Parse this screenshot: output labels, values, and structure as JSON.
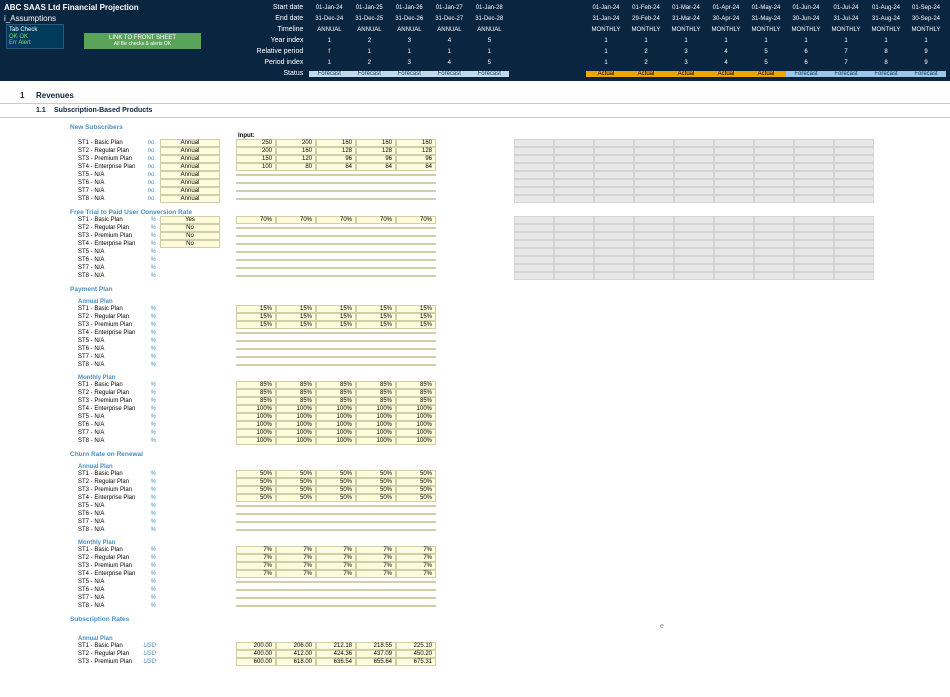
{
  "header": {
    "title": "ABC SAAS Ltd Financial Projection",
    "subtitle": "i_Assumptions",
    "labels": [
      "Start date",
      "End date",
      "Timeline",
      "Year index",
      "Relative period",
      "Period index",
      "Status"
    ],
    "years": [
      "01-Jan-24",
      "01-Jan-25",
      "01-Jan-26",
      "01-Jan-27",
      "01-Jan-28"
    ],
    "years_end": [
      "31-Dec-24",
      "31-Dec-25",
      "31-Dec-26",
      "31-Dec-27",
      "31-Dec-28"
    ],
    "years_timeline": [
      "ANNUAL",
      "ANNUAL",
      "ANNUAL",
      "ANNUAL",
      "ANNUAL"
    ],
    "years_index": [
      "1",
      "2",
      "3",
      "4",
      "5"
    ],
    "years_rel": [
      "f",
      "1",
      "1",
      "1",
      "1"
    ],
    "years_pidx": [
      "1",
      "2",
      "3",
      "4",
      "5"
    ],
    "months": [
      "01-Jan-24",
      "01-Feb-24",
      "01-Mar-24",
      "01-Apr-24",
      "01-May-24",
      "01-Jun-24",
      "01-Jul-24",
      "01-Aug-24",
      "01-Sep-24"
    ],
    "months_end": [
      "31-Jan-24",
      "29-Feb-24",
      "31-Mar-24",
      "30-Apr-24",
      "31-May-24",
      "30-Jun-24",
      "31-Jul-24",
      "31-Aug-24",
      "30-Sep-24"
    ],
    "months_timeline": [
      "MONTHLY",
      "MONTHLY",
      "MONTHLY",
      "MONTHLY",
      "MONTHLY",
      "MONTHLY",
      "MONTHLY",
      "MONTHLY",
      "MONTHLY"
    ],
    "months_yidx": [
      "1",
      "1",
      "1",
      "1",
      "1",
      "1",
      "1",
      "1",
      "1"
    ],
    "months_rel": [
      "1",
      "2",
      "3",
      "4",
      "5",
      "6",
      "7",
      "8",
      "9"
    ],
    "months_pidx": [
      "1",
      "2",
      "3",
      "4",
      "5",
      "6",
      "7",
      "8",
      "9"
    ],
    "status_years": [
      "Forecast",
      "Forecast",
      "Forecast",
      "Forecast",
      "Forecast"
    ],
    "status_months": [
      "Actual",
      "Actual",
      "Actual",
      "Actual",
      "Actual",
      "Forecast",
      "Forecast",
      "Forecast",
      "Forecast"
    ]
  },
  "tabcheck": {
    "title": "Tab Check",
    "ok": "OK  OK",
    "err": "Err",
    "alert": "Alert"
  },
  "linksheet": {
    "main": "LINK TO FRONT SHEET",
    "sub": "All file checks & alerts OK"
  },
  "section": {
    "num": "1",
    "title": "Revenues"
  },
  "subsection": {
    "num": "1.1",
    "title": "Subscription-Based Products"
  },
  "plans": [
    "ST1 - Basic Plan",
    "ST2 - Regular Plan",
    "ST3 - Premium Plan",
    "ST4 - Enterprise Plan",
    "ST5 - N/A",
    "ST6 - N/A",
    "ST7 - N/A",
    "ST8 - N/A"
  ],
  "blocks": {
    "newsubs": {
      "title": "New Subscribers",
      "input_label": "Input:",
      "unit": "no.",
      "freq": [
        "Annual",
        "Annual",
        "Annual",
        "Annual",
        "Annual",
        "Annual",
        "Annual",
        "Annual"
      ],
      "data": [
        [
          "250",
          "200",
          "160",
          "160",
          "160"
        ],
        [
          "200",
          "160",
          "128",
          "128",
          "128"
        ],
        [
          "150",
          "120",
          "96",
          "96",
          "96"
        ],
        [
          "100",
          "80",
          "64",
          "64",
          "64"
        ],
        [
          "",
          "",
          "",
          "",
          ""
        ],
        [
          "",
          "",
          "",
          "",
          ""
        ],
        [
          "",
          "",
          "",
          "",
          ""
        ],
        [
          "",
          "",
          "",
          "",
          ""
        ]
      ]
    },
    "freetrial": {
      "title": "Free Trial to Paid User Conversion Rate",
      "unit": "%",
      "freq": [
        "Yes",
        "No",
        "No",
        "No",
        "",
        "",
        "",
        ""
      ],
      "data": [
        [
          "70%",
          "70%",
          "70%",
          "70%",
          "70%"
        ],
        [
          "",
          "",
          "",
          "",
          ""
        ],
        [
          "",
          "",
          "",
          "",
          ""
        ],
        [
          "",
          "",
          "",
          "",
          ""
        ],
        [
          "",
          "",
          "",
          "",
          ""
        ],
        [
          "",
          "",
          "",
          "",
          ""
        ],
        [
          "",
          "",
          "",
          "",
          ""
        ],
        [
          "",
          "",
          "",
          "",
          ""
        ]
      ],
      "grey": true
    },
    "payment": {
      "title": "Payment Plan"
    },
    "annualplan": {
      "subtitle": "Annual Plan",
      "unit": "%",
      "data": [
        [
          "15%",
          "15%",
          "15%",
          "15%",
          "15%"
        ],
        [
          "15%",
          "15%",
          "15%",
          "15%",
          "15%"
        ],
        [
          "15%",
          "15%",
          "15%",
          "15%",
          "15%"
        ],
        [
          "",
          "",
          "",
          "",
          ""
        ],
        [
          "",
          "",
          "",
          "",
          ""
        ],
        [
          "",
          "",
          "",
          "",
          ""
        ],
        [
          "",
          "",
          "",
          "",
          ""
        ],
        [
          "",
          "",
          "",
          "",
          ""
        ]
      ]
    },
    "monthlyplan": {
      "subtitle": "Monthly Plan",
      "unit": "%",
      "data": [
        [
          "85%",
          "85%",
          "85%",
          "85%",
          "85%"
        ],
        [
          "85%",
          "85%",
          "85%",
          "85%",
          "85%"
        ],
        [
          "85%",
          "85%",
          "85%",
          "85%",
          "85%"
        ],
        [
          "100%",
          "100%",
          "100%",
          "100%",
          "100%"
        ],
        [
          "100%",
          "100%",
          "100%",
          "100%",
          "100%"
        ],
        [
          "100%",
          "100%",
          "100%",
          "100%",
          "100%"
        ],
        [
          "100%",
          "100%",
          "100%",
          "100%",
          "100%"
        ],
        [
          "100%",
          "100%",
          "100%",
          "100%",
          "100%"
        ]
      ]
    },
    "churn": {
      "title": "Churn Rate on Renewal"
    },
    "churn_annual": {
      "subtitle": "Annual Plan",
      "unit": "%",
      "data": [
        [
          "50%",
          "50%",
          "50%",
          "50%",
          "50%"
        ],
        [
          "50%",
          "50%",
          "50%",
          "50%",
          "50%"
        ],
        [
          "50%",
          "50%",
          "50%",
          "50%",
          "50%"
        ],
        [
          "50%",
          "50%",
          "50%",
          "50%",
          "50%"
        ],
        [
          "",
          "",
          "",
          "",
          ""
        ],
        [
          "",
          "",
          "",
          "",
          ""
        ],
        [
          "",
          "",
          "",
          "",
          ""
        ],
        [
          "",
          "",
          "",
          "",
          ""
        ]
      ]
    },
    "churn_monthly": {
      "subtitle": "Monthly Plan",
      "unit": "%",
      "data": [
        [
          "7%",
          "7%",
          "7%",
          "7%",
          "7%"
        ],
        [
          "7%",
          "7%",
          "7%",
          "7%",
          "7%"
        ],
        [
          "7%",
          "7%",
          "7%",
          "7%",
          "7%"
        ],
        [
          "7%",
          "7%",
          "7%",
          "7%",
          "7%"
        ],
        [
          "",
          "",
          "",
          "",
          ""
        ],
        [
          "",
          "",
          "",
          "",
          ""
        ],
        [
          "",
          "",
          "",
          "",
          ""
        ],
        [
          "",
          "",
          "",
          "",
          ""
        ]
      ]
    },
    "rates": {
      "title": "Subscription Rates",
      "marker": "e"
    },
    "rates_annual": {
      "subtitle": "Annual Plan",
      "unit": "USD",
      "plans": [
        "ST1 - Basic Plan",
        "ST2 - Regular Plan",
        "ST3 - Premium Plan"
      ],
      "data": [
        [
          "200.00",
          "206.00",
          "212.18",
          "218.55",
          "225.10"
        ],
        [
          "400.00",
          "412.00",
          "424.36",
          "437.09",
          "450.20"
        ],
        [
          "600.00",
          "618.00",
          "636.54",
          "655.64",
          "675.31"
        ]
      ]
    }
  }
}
